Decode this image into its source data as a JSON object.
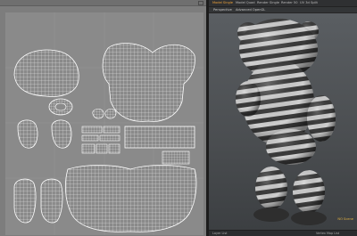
{
  "viewport_tabs": [
    {
      "label": "Model Single",
      "active": true
    },
    {
      "label": "Model Quad",
      "active": false
    },
    {
      "label": "Render Single",
      "active": false
    },
    {
      "label": "Render 50",
      "active": false
    },
    {
      "label": "UV 3d Split",
      "active": false
    }
  ],
  "viewport": {
    "view_mode": "Perspective",
    "shading": "Advanced OpenGL",
    "stat_label": "NO Scene"
  },
  "status": {
    "left": "Layer List",
    "right": "Vertex Map List"
  },
  "colors": {
    "uv_background": "#8a8a8a",
    "viewport_background": "#55585b",
    "active_tab": "#f0a43a"
  }
}
